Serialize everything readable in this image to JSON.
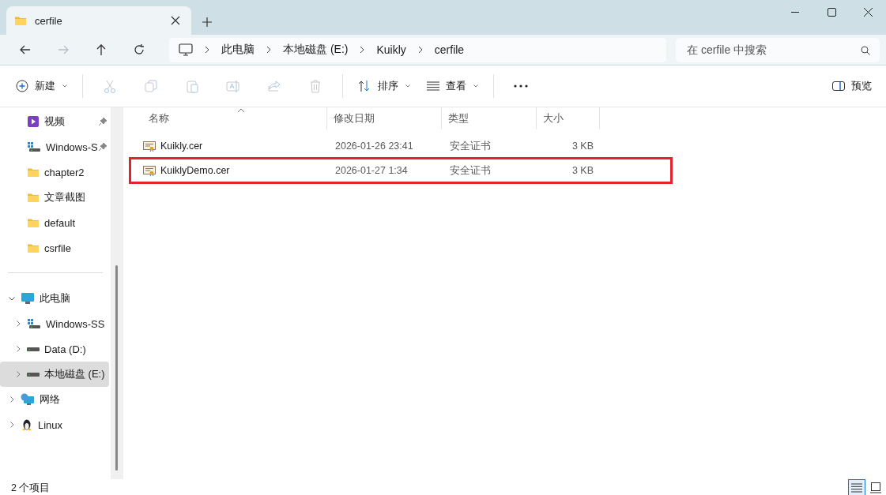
{
  "window": {
    "tab": {
      "title": "cerfile"
    }
  },
  "nav": [
    {
      "kind": "back",
      "disabled": false
    },
    {
      "kind": "forward",
      "disabled": true
    },
    {
      "kind": "up",
      "disabled": false
    },
    {
      "kind": "refresh",
      "disabled": false
    }
  ],
  "address": {
    "segments": [
      "此电脑",
      "本地磁盘 (E:)",
      "Kuikly",
      "cerfile"
    ]
  },
  "search": {
    "placeholder": "在 cerfile 中搜索"
  },
  "toolbar": {
    "new": "新建",
    "actions": [
      {
        "kind": "cut",
        "disabled": true
      },
      {
        "kind": "copy",
        "disabled": true
      },
      {
        "kind": "paste",
        "disabled": true
      },
      {
        "kind": "rename",
        "disabled": true
      },
      {
        "kind": "share",
        "disabled": true
      },
      {
        "kind": "delete",
        "disabled": true
      }
    ],
    "sort": "排序",
    "view": "查看",
    "preview": "预览"
  },
  "sidebar": {
    "quick_access": [
      {
        "label": "视频",
        "kind": "video",
        "pinned": true
      },
      {
        "label": "Windows-S",
        "kind": "system-drive",
        "pinned": true
      },
      {
        "label": "chapter2",
        "kind": "folder",
        "pinned": false
      },
      {
        "label": "文章截图",
        "kind": "folder",
        "pinned": false
      },
      {
        "label": "default",
        "kind": "folder",
        "pinned": false
      },
      {
        "label": "csrfile",
        "kind": "folder",
        "pinned": false
      }
    ],
    "tree": [
      {
        "label": "此电脑",
        "kind": "pc",
        "expanded": true,
        "selected": false,
        "children": [
          {
            "label": "Windows-SS",
            "kind": "system-drive",
            "expanded": false,
            "selected": false
          },
          {
            "label": "Data (D:)",
            "kind": "drive",
            "expanded": false,
            "selected": false
          },
          {
            "label": "本地磁盘 (E:)",
            "kind": "drive",
            "expanded": false,
            "selected": true
          }
        ]
      },
      {
        "label": "网络",
        "kind": "network",
        "expanded": false,
        "selected": false
      },
      {
        "label": "Linux",
        "kind": "linux",
        "expanded": false,
        "selected": false
      }
    ]
  },
  "table": {
    "columns": [
      "名称",
      "修改日期",
      "类型",
      "大小"
    ],
    "rows": [
      {
        "name": "Kuikly.cer",
        "modified": "2026-01-26 23:41",
        "type": "安全证书",
        "size": "3 KB",
        "highlighted": false
      },
      {
        "name": "KuiklyDemo.cer",
        "modified": "2026-01-27 1:34",
        "type": "安全证书",
        "size": "3 KB",
        "highlighted": true
      }
    ]
  },
  "status_bar": {
    "count": "2 个项目",
    "views": [
      {
        "kind": "details",
        "selected": true
      },
      {
        "kind": "tiles",
        "selected": false
      }
    ]
  }
}
